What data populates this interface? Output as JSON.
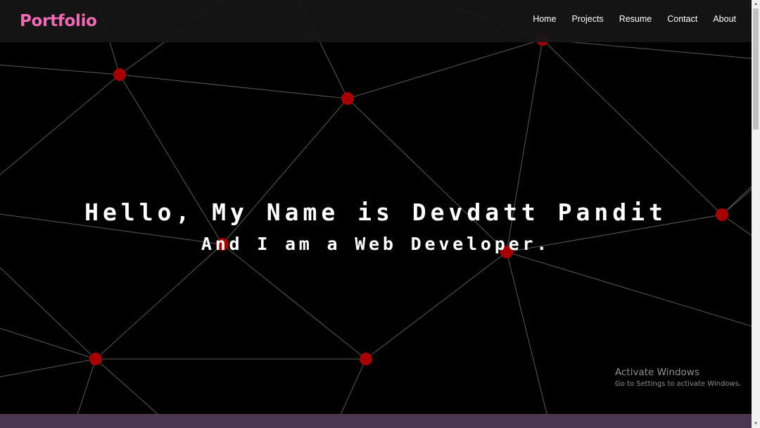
{
  "navbar": {
    "brand": "Portfolio",
    "links": [
      {
        "label": "Home"
      },
      {
        "label": "Projects"
      },
      {
        "label": "Resume"
      },
      {
        "label": "Contact"
      },
      {
        "label": "About"
      }
    ]
  },
  "hero": {
    "title": "Hello, My Name is Devdatt Pandit",
    "subtitle": "And I am a Web Developer."
  },
  "watermark": {
    "title": "Activate Windows",
    "subtitle": "Go to Settings to activate Windows."
  },
  "colors": {
    "brand": "#f06ab4",
    "node": "#a60000",
    "line": "#5a5a5a",
    "background": "#000000",
    "footer": "#4b3650"
  },
  "icons": {
    "scroll_up": "triangle-up-icon",
    "scroll_down": "triangle-down-icon"
  }
}
